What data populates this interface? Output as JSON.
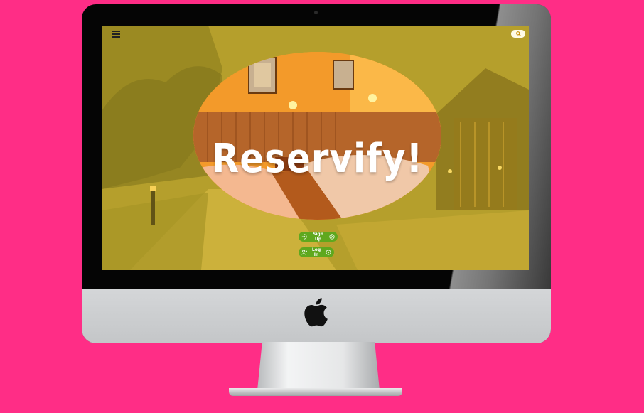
{
  "app": {
    "title": "Reservify!",
    "menu_icon": "hamburger-menu-icon",
    "search_icon": "search-icon"
  },
  "buttons": {
    "signup_label": "Sign Up",
    "login_label": "Log In"
  },
  "colors": {
    "background": "#ff2d86",
    "button_green": "#5fa81e",
    "overlay_yellow": "#e6be28"
  }
}
